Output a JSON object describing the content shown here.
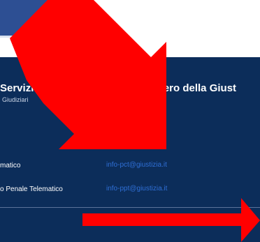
{
  "footer": {
    "brand": {
      "title": "Servizi",
      "subtitle": "Giudiziari"
    },
    "ministry": "inistero della Giust",
    "contacts": [
      {
        "label": "matico",
        "email": "info-pct@giustizia.it"
      },
      {
        "label": "o Penale Telematico",
        "email": "info-ppt@giustizia.it"
      }
    ]
  },
  "annotations": {
    "arrow_color": "#ff0000"
  },
  "colors": {
    "footer_bg": "#0c2d5a",
    "header_tab": "#2d4f93",
    "link": "#2f6fd6"
  },
  "icons": [
    "arrow-down-right-annotation",
    "arrow-right-annotation"
  ]
}
